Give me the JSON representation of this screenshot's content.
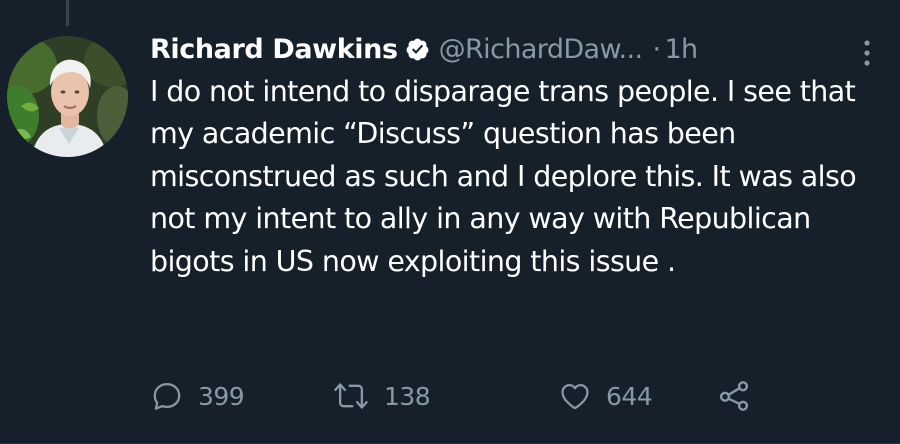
{
  "colors": {
    "background": "#15202b",
    "primary_text": "#ffffff",
    "secondary_text": "#8899a6",
    "verified_badge": "#ffffff"
  },
  "tweet": {
    "author": {
      "name": "Richard Dawkins",
      "handle": "@RichardDaw...",
      "verified": true,
      "avatar_icon": "profile-photo"
    },
    "separator": "·",
    "time": "1h",
    "text": "I do not intend to disparage trans people. I see that my academic “Discuss” question has been misconstrued as such and I deplore this. It was also not my intent to ally in any way with Republican bigots in US now exploiting this issue .",
    "actions": {
      "reply": {
        "icon": "reply-icon",
        "count": "399"
      },
      "retweet": {
        "icon": "retweet-icon",
        "count": "138"
      },
      "like": {
        "icon": "heart-icon",
        "count": "644"
      },
      "share": {
        "icon": "share-icon"
      }
    },
    "menu_icon": "more-icon"
  }
}
